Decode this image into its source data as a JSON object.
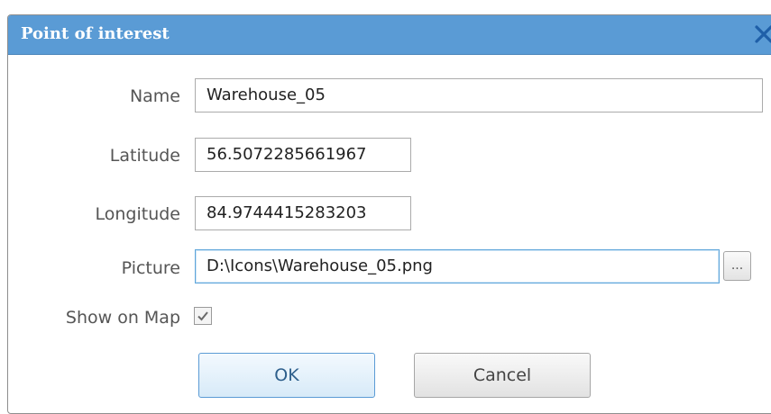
{
  "dialog": {
    "title": "Point of interest",
    "close_icon": "close-icon"
  },
  "form": {
    "name_label": "Name",
    "name_value": "Warehouse_05",
    "latitude_label": "Latitude",
    "latitude_value": "56.5072285661967",
    "longitude_label": "Longitude",
    "longitude_value": "84.9744415283203",
    "picture_label": "Picture",
    "picture_value": "D:\\Icons\\Warehouse_05.png",
    "browse_label": "...",
    "show_on_map_label": "Show on Map",
    "show_on_map_checked": true
  },
  "buttons": {
    "ok_label": "OK",
    "cancel_label": "Cancel"
  },
  "colors": {
    "titlebar": "#5a9bd5",
    "close_icon": "#1f5fa8",
    "focus_border": "#5fa6db"
  }
}
